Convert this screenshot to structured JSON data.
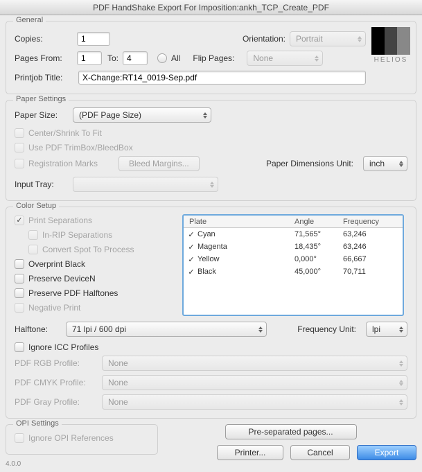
{
  "window_title": "PDF HandShake Export For Imposition:ankh_TCP_Create_PDF",
  "brand": "HELIOS",
  "version": "4.0.0",
  "general": {
    "title": "General",
    "copies_label": "Copies:",
    "copies_value": "1",
    "orientation_label": "Orientation:",
    "orientation_value": "Portrait",
    "pages_from_label": "Pages From:",
    "from_value": "1",
    "to_label": "To:",
    "to_value": "4",
    "all_label": "All",
    "flip_label": "Flip Pages:",
    "flip_value": "None",
    "printjob_label": "Printjob Title:",
    "printjob_value": "X-Change:RT14_0019-Sep.pdf"
  },
  "paper": {
    "title": "Paper Settings",
    "size_label": "Paper Size:",
    "size_value": "(PDF Page Size)",
    "center_label": "Center/Shrink To Fit",
    "trimbox_label": "Use PDF TrimBox/BleedBox",
    "regmarks_label": "Registration Marks",
    "bleed_button": "Bleed Margins...",
    "unit_label": "Paper Dimensions Unit:",
    "unit_value": "inch",
    "tray_label": "Input Tray:",
    "tray_value": ""
  },
  "color": {
    "title": "Color Setup",
    "print_sep_label": "Print Separations",
    "inrip_label": "In-RIP Separations",
    "convert_spot_label": "Convert Spot To Process",
    "overprint_label": "Overprint Black",
    "pres_devicen_label": "Preserve DeviceN",
    "pres_halftone_label": "Preserve PDF Halftones",
    "negative_label": "Negative Print",
    "halftone_label": "Halftone:",
    "halftone_value": "71 lpi / 600 dpi",
    "frequnit_label": "Frequency Unit:",
    "frequnit_value": "lpi",
    "ignore_icc_label": "Ignore ICC Profiles",
    "rgb_label": "PDF RGB Profile:",
    "cmyk_label": "PDF CMYK Profile:",
    "gray_label": "PDF Gray Profile:",
    "none_value": "None",
    "plate_headers": {
      "plate": "Plate",
      "angle": "Angle",
      "freq": "Frequency"
    },
    "plates": [
      {
        "name": "Cyan",
        "angle": "71,565°",
        "freq": "63,246"
      },
      {
        "name": "Magenta",
        "angle": "18,435°",
        "freq": "63,246"
      },
      {
        "name": "Yellow",
        "angle": "0,000°",
        "freq": "66,667"
      },
      {
        "name": "Black",
        "angle": "45,000°",
        "freq": "70,711"
      }
    ]
  },
  "opi": {
    "title": "OPI Settings",
    "ignore_label": "Ignore OPI References"
  },
  "buttons": {
    "presep": "Pre-separated pages...",
    "printer": "Printer...",
    "cancel": "Cancel",
    "export": "Export"
  }
}
